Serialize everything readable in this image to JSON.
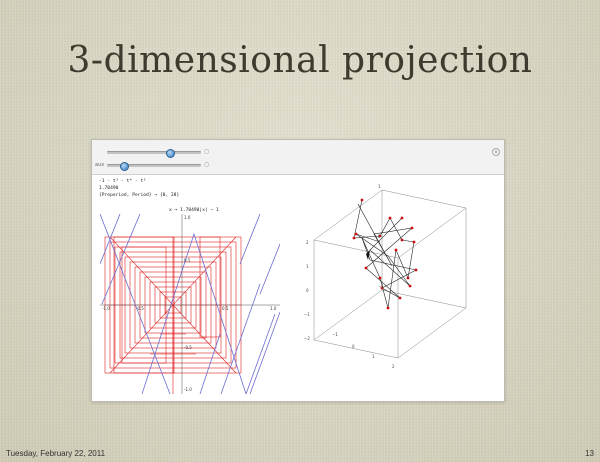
{
  "slide": {
    "title": "3-dimensional projection",
    "footer_date": "Tuesday, February 22, 2011",
    "page_number": "13"
  },
  "controls": {
    "slider1": {
      "label": "",
      "value": 0.67
    },
    "slider2": {
      "label": "aux",
      "value": 0.18
    },
    "plus_label": "○",
    "close_label": "⊗"
  },
  "output": {
    "line1": "-1 - t³ - t⁴ - t⁵",
    "line2": "1.70490",
    "line3": "{Preperiod, Period} → {0, 28}",
    "map_label": "x → 1.70490|x| − 1"
  },
  "plot2d": {
    "x_ticks": [
      "-1.0",
      "-0.5",
      "0.5",
      "1.0"
    ],
    "y_ticks": [
      "1.0",
      "0.5",
      "-0.5",
      "-1.0"
    ]
  },
  "plot3d": {
    "tick_labels": [
      "1",
      "0",
      "−1",
      "2",
      "1",
      "0",
      "−1",
      "−2",
      "−1",
      "0",
      "1",
      "2"
    ]
  },
  "colors": {
    "cobweb": "#e02020",
    "tent": "#6a6fd0",
    "axis": "#555555",
    "node": "#cc1010"
  }
}
